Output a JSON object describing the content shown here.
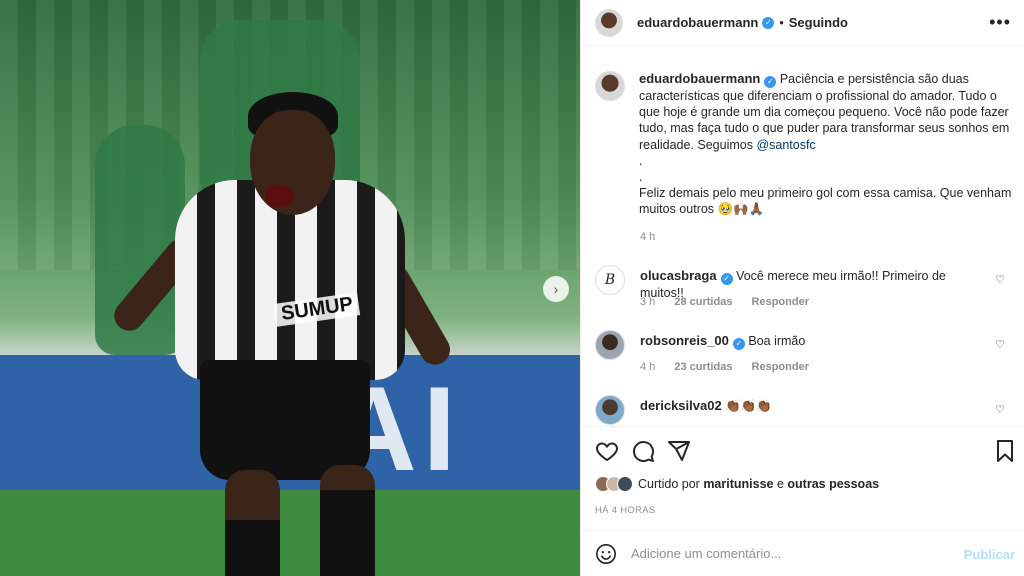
{
  "post": {
    "username": "eduardobauermann",
    "verified": true,
    "follow_status": "Seguindo",
    "caption_p1": "Paciência e persistência são duas características que diferenciam o profissional do amador. Tudo o que hoje é grande um dia começou pequeno. Você não pode fazer tudo, mas faça tudo o que puder para transformar seus sonhos em realidade. Seguimos ",
    "caption_mention": "@santosfc",
    "caption_dot1": ".",
    "caption_dot2": ".",
    "caption_p2": "Feliz demais pelo meu primeiro gol com essa camisa. Que venham muitos outros 🥹🙌🏾🙏🏾",
    "caption_time": "4 h"
  },
  "photo": {
    "sponsor_text": "SUMUP",
    "banner_text": "AI"
  },
  "comments": [
    {
      "username": "olucasbraga",
      "verified": true,
      "text": "Você merece meu irmão!! Primeiro de muitos!!",
      "time": "3 h",
      "likes": "28 curtidas",
      "reply": "Responder"
    },
    {
      "username": "robsonreis_00",
      "verified": true,
      "text": "Boa irmão",
      "time": "4 h",
      "likes": "23 curtidas",
      "reply": "Responder"
    },
    {
      "username": "dericksilva02",
      "verified": false,
      "text": "👏🏾👏🏾👏🏾",
      "time": "",
      "likes": "",
      "reply": ""
    }
  ],
  "likes": {
    "prefix": "Curtido por ",
    "user": "maritunisse",
    "connector": " e ",
    "others": "outras pessoas"
  },
  "timestamp": "HÁ 4 HORAS",
  "add_comment": {
    "placeholder": "Adicione um comentário...",
    "publish_label": "Publicar"
  },
  "icons": {
    "more": "more-options-icon",
    "heart": "heart-icon",
    "comment": "comment-icon",
    "share": "share-icon",
    "save": "bookmark-icon",
    "emoji": "emoji-icon",
    "next": "chevron-right-icon"
  },
  "colors": {
    "verified": "#3897f0",
    "mention": "#00376b",
    "publish_disabled": "#b2dffc",
    "secondary_text": "#8e8e8e"
  }
}
